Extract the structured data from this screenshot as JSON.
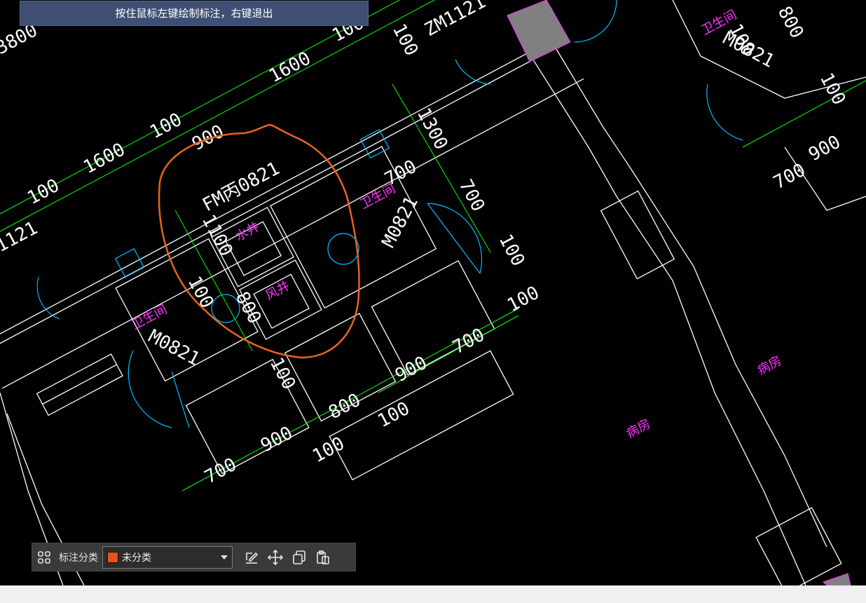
{
  "hint": {
    "text": "按住鼠标左键绘制标注，右键退出"
  },
  "toolbar": {
    "category_label": "标注分类",
    "category_value": "未分类",
    "category_color": "#e8521a",
    "icons": [
      "grid-icon",
      "edit-icon",
      "move-icon",
      "copy-icon",
      "paste-icon"
    ]
  },
  "drawing": {
    "colors": {
      "background": "#000000",
      "wall": "#ffffff",
      "dimension": "#00ff00",
      "dimension_text": "#ffffff",
      "fixture": "#00bfff",
      "room_label": "#ff33ff",
      "annotation": "#e8641e"
    },
    "dimension_texts": [
      "3800",
      "1600",
      "100",
      "1600",
      "100",
      "100",
      "900",
      "700",
      "1300",
      "700",
      "100",
      "1100",
      "100",
      "800",
      "100",
      "700",
      "900",
      "100",
      "800",
      "900",
      "700",
      "100",
      "900",
      "700",
      "100",
      "100",
      "100",
      "800",
      "100",
      "ZM1121",
      "M0821",
      "M0821",
      "M0821",
      "ZM1121",
      "FM丙0821",
      "1121",
      "ZM1121",
      "100"
    ],
    "room_labels": [
      "卫生间",
      "卫生间",
      "水井",
      "风井",
      "卫生间",
      "病房",
      "病房"
    ]
  }
}
